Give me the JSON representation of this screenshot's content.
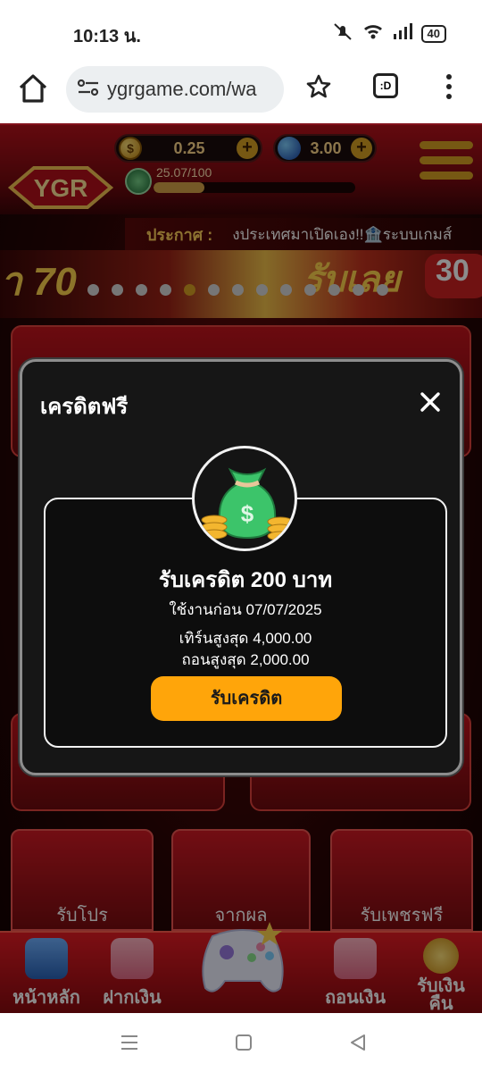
{
  "status_bar": {
    "time": "10:13 น.",
    "battery": "40",
    "icons": [
      "mute-icon",
      "wifi-icon",
      "signal-icon",
      "battery-icon"
    ]
  },
  "browser": {
    "url": "ygrgame.com/wa",
    "tabs_label": ":D"
  },
  "site": {
    "logo_text": "YGR",
    "coins": "0.25",
    "gems": "3.00",
    "level_text": "25.07/100",
    "level_progress": 0.25,
    "announcement_label": "ประกาศ :",
    "announcement_text": "งประเทศมาเปิดเอง!!🏦ระบบเกมส์",
    "banner_left": "า 70",
    "banner_right": "รับเลย",
    "banner_badge": "30",
    "slide_count": 13,
    "active_slide": 4,
    "tiles": [
      {
        "label": "รับโปร"
      },
      {
        "label": "จากผล"
      },
      {
        "label": "รับเพชรฟรี"
      }
    ],
    "nav": {
      "home": "หน้าหลัก",
      "deposit": "ฝากเงิน",
      "withdraw": "ถอนเงิน",
      "cashback": "รับเงินคืน"
    }
  },
  "modal": {
    "title": "เครดิตฟรี",
    "credit_title": "รับเครดิต 200 บาท",
    "expiry": "ใช้งานก่อน 07/07/2025",
    "max_turnover": "เทิร์นสูงสุด 4,000.00",
    "max_withdraw": "ถอนสูงสุด 2,000.00",
    "claim_button": "รับเครดิต"
  },
  "colors": {
    "accent_gold": "#d8a023",
    "brand_red": "#c3141d",
    "claim_orange": "#ffa50a",
    "modal_bg": "#161616"
  }
}
